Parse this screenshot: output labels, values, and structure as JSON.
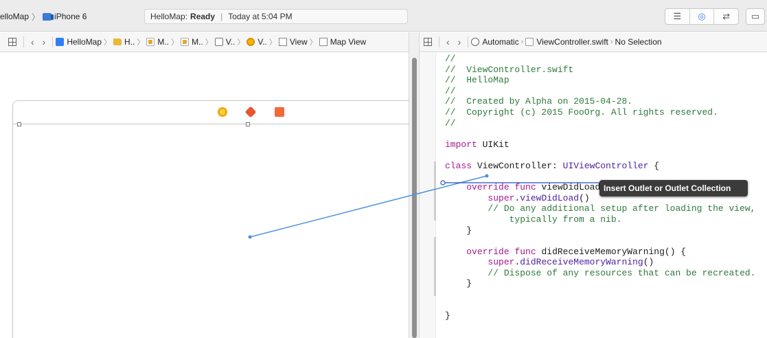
{
  "toolbar": {
    "scheme_app": "elloMap",
    "scheme_device": "iPhone 6",
    "activity_app": "HelloMap:",
    "activity_status": "Ready",
    "activity_time": "Today at 5:04 PM",
    "buttons": [
      "standard-editor",
      "assistant-editor",
      "version-editor",
      "navigator-toggle"
    ]
  },
  "left_jumpbar": {
    "crumbs": [
      "HelloMap",
      "H..",
      "M..",
      "M..",
      "V..",
      "V..",
      "View",
      "Map View"
    ]
  },
  "right_jumpbar": {
    "mode": "Automatic",
    "file": "ViewController.swift",
    "selection": "No Selection"
  },
  "code": {
    "lines": [
      [
        {
          "t": "//",
          "c": "comment"
        }
      ],
      [
        {
          "t": "//  ViewController.swift",
          "c": "comment"
        }
      ],
      [
        {
          "t": "//  HelloMap",
          "c": "comment"
        }
      ],
      [
        {
          "t": "//",
          "c": "comment"
        }
      ],
      [
        {
          "t": "//  Created by Alpha on 2015-04-28.",
          "c": "comment"
        }
      ],
      [
        {
          "t": "//  Copyright (c) 2015 FooOrg. All rights reserved.",
          "c": "comment"
        }
      ],
      [
        {
          "t": "//",
          "c": "comment"
        }
      ],
      [
        {
          "t": "",
          "c": "plain"
        }
      ],
      [
        {
          "t": "import",
          "c": "kw"
        },
        {
          "t": " UIKit",
          "c": "plain"
        }
      ],
      [
        {
          "t": "",
          "c": "plain"
        }
      ],
      [
        {
          "t": "class",
          "c": "kw"
        },
        {
          "t": " ViewController: ",
          "c": "plain"
        },
        {
          "t": "UIViewController",
          "c": "type"
        },
        {
          "t": " {",
          "c": "plain"
        }
      ],
      [
        {
          "t": "",
          "c": "plain"
        }
      ],
      [
        {
          "t": "    ",
          "c": "plain"
        },
        {
          "t": "override",
          "c": "kw"
        },
        {
          "t": " ",
          "c": "plain"
        },
        {
          "t": "func",
          "c": "kw"
        },
        {
          "t": " viewDidLoad() {",
          "c": "plain"
        }
      ],
      [
        {
          "t": "        ",
          "c": "plain"
        },
        {
          "t": "super",
          "c": "kw"
        },
        {
          "t": ".",
          "c": "plain"
        },
        {
          "t": "viewDidLoad",
          "c": "call"
        },
        {
          "t": "()",
          "c": "plain"
        }
      ],
      [
        {
          "t": "        // Do any additional setup after loading the view,",
          "c": "comment"
        }
      ],
      [
        {
          "t": "            typically from a nib.",
          "c": "comment"
        }
      ],
      [
        {
          "t": "    }",
          "c": "plain"
        }
      ],
      [
        {
          "t": "",
          "c": "plain"
        }
      ],
      [
        {
          "t": "    ",
          "c": "plain"
        },
        {
          "t": "override",
          "c": "kw"
        },
        {
          "t": " ",
          "c": "plain"
        },
        {
          "t": "func",
          "c": "kw"
        },
        {
          "t": " didReceiveMemoryWarning() {",
          "c": "plain"
        }
      ],
      [
        {
          "t": "        ",
          "c": "plain"
        },
        {
          "t": "super",
          "c": "kw"
        },
        {
          "t": ".",
          "c": "plain"
        },
        {
          "t": "didReceiveMemoryWarning",
          "c": "call"
        },
        {
          "t": "()",
          "c": "plain"
        }
      ],
      [
        {
          "t": "        // Dispose of any resources that can be recreated.",
          "c": "comment"
        }
      ],
      [
        {
          "t": "    }",
          "c": "plain"
        }
      ],
      [
        {
          "t": "",
          "c": "plain"
        }
      ],
      [
        {
          "t": "",
          "c": "plain"
        }
      ],
      [
        {
          "t": "}",
          "c": "plain"
        }
      ]
    ]
  },
  "tooltip": {
    "text": "Insert Outlet or Outlet Collection"
  },
  "colors": {
    "connection_line": "#4a90e2",
    "comment": "#2d7a3a",
    "keyword": "#a3198e",
    "type": "#4b1f9e"
  }
}
